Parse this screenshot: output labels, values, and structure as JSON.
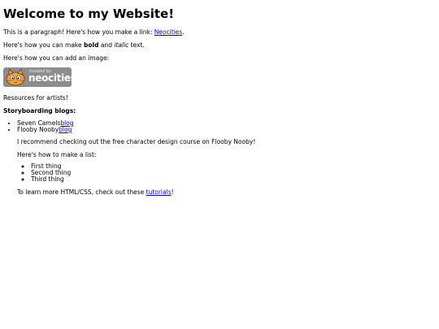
{
  "page": {
    "title": "Welcome to my Website!",
    "para1_prefix": "This is a paragraph! Here's how you make a link: ",
    "para1_link": "Neocities",
    "para1_suffix": ".",
    "para2_prefix": "Here's how you can make ",
    "para2_bold": "bold",
    "para2_middle": " and ",
    "para2_italic": "italic",
    "para2_suffix": " text.",
    "para3": "Here's how you can add an image:",
    "badge": {
      "hosted": "hosted by",
      "brand": "neocities",
      "icon": "neocities-cat-icon"
    },
    "resources": "Resources for artists!",
    "blogs_title": "Storyboarding blogs:",
    "blogs": [
      {
        "name": "Seven Camels",
        "link": "blog"
      },
      {
        "name": "Flooby Nooby",
        "link": "blog"
      }
    ],
    "recommend": "I recommend checking out the free character design course on Flooby Nooby!",
    "list_intro": "Here's how to make a list:",
    "list_items": [
      "First thing",
      "Second thing",
      "Third thing"
    ],
    "learn_prefix": "To learn more HTML/CSS, check out these ",
    "learn_link": "tutorials",
    "learn_suffix": "!"
  }
}
